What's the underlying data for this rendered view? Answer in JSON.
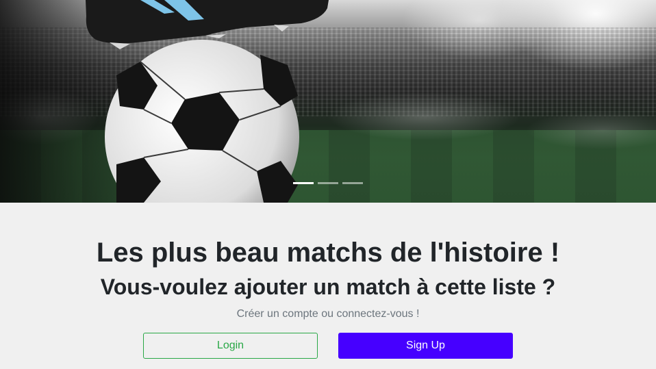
{
  "carousel": {
    "indicators": [
      {
        "active": true
      },
      {
        "active": false
      },
      {
        "active": false
      }
    ]
  },
  "hero_text": {
    "headline": "Les plus beau matchs de l'histoire !",
    "subheadline": "Vous-voulez ajouter un match à cette liste ?",
    "lead": "Créer un compte ou connectez-vous !"
  },
  "actions": {
    "login_label": "Login",
    "signup_label": "Sign Up"
  },
  "colors": {
    "login_outline": "#28a745",
    "signup_bg": "#4600ff"
  }
}
